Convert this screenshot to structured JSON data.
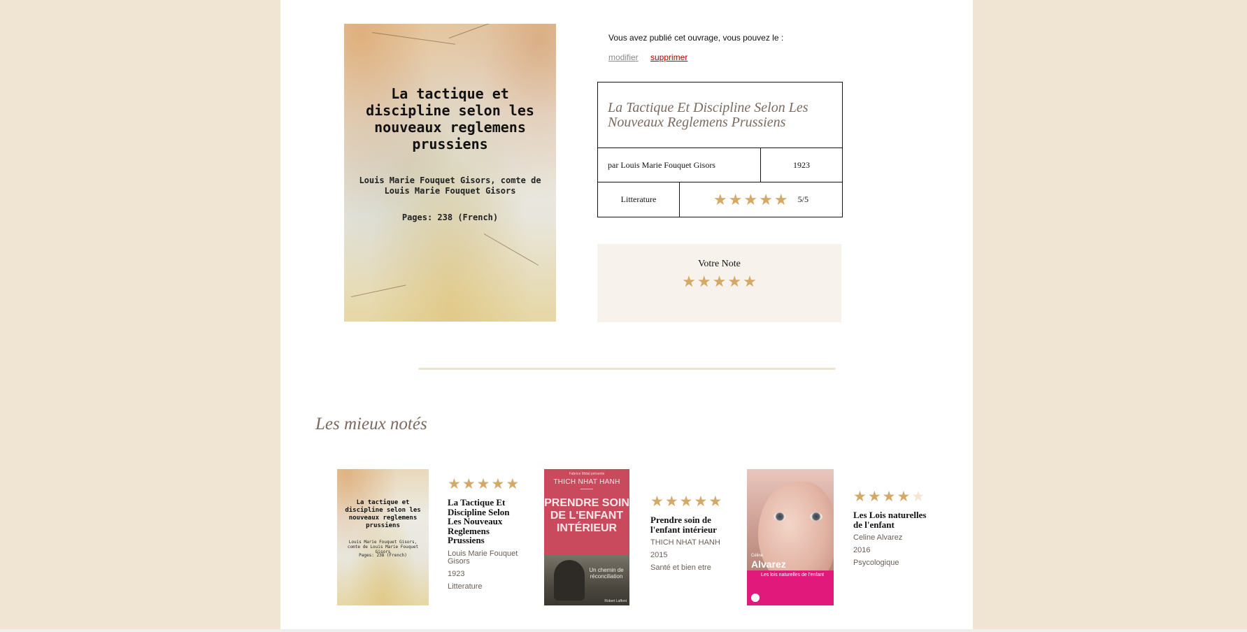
{
  "book": {
    "cover": {
      "title": "La tactique et discipline selon les nouveaux reglemens prussiens",
      "author": "Louis Marie Fouquet Gisors, comte de Louis Marie Fouquet Gisors",
      "pages": "Pages: 238 (French)"
    },
    "title": "La Tactique Et Discipline Selon Les Nouveaux Reglemens Prussiens",
    "author": "par Louis Marie Fouquet Gisors",
    "year": "1923",
    "genre": "Litterature",
    "rating_score": "5/5",
    "rating": 5
  },
  "owner": {
    "note": "Vous avez publié cet ouvrage, vous pouvez le :",
    "edit_label": "modifier",
    "delete_label": "supprimer"
  },
  "your_rating": {
    "label": "Votre Note",
    "stars": 5
  },
  "top_rated": {
    "title": "Les mieux notés",
    "items": [
      {
        "title": "La Tactique Et Discipline Selon Les Nouveaux Reglemens Prussiens",
        "author": "Louis Marie Fouquet Gisors",
        "year": "1923",
        "genre": "Litterature",
        "rating": 5,
        "cover": {
          "title": "La tactique et discipline selon les nouveaux reglemens prussiens",
          "author": "Louis Marie Fouquet Gisors, comte de Louis Marie Fouquet Gisors",
          "pages": "Pages: 238 (French)"
        }
      },
      {
        "title": "Prendre soin de l'enfant intérieur",
        "author": "THICH NHAT HANH",
        "year": "2015",
        "genre": "Santé et bien etre",
        "rating": 5,
        "cover": {
          "top": "Fabrice Midal présente",
          "author": "THICH NHAT HANH",
          "title": "PRENDRE SOIN DE L'ENFANT INTÉRIEUR",
          "subtitle": "Un chemin de réconciliation",
          "publisher": "Robert Laffont"
        }
      },
      {
        "title": "Les Lois naturelles de l'enfant",
        "author": "Celine Alvarez",
        "year": "2016",
        "genre": "Psycologique",
        "rating": 4,
        "cover": {
          "author_first": "Céline",
          "author_last": "Alvarez",
          "subtitle": "Les lois naturelles de l'enfant"
        }
      }
    ]
  },
  "colors": {
    "background": "#f0e4d3",
    "star_filled": "#d4a866",
    "star_empty": "#f3e6d2",
    "delete_link": "#b00000",
    "heading": "#7a6a60"
  },
  "icons": [
    "star-icon"
  ]
}
